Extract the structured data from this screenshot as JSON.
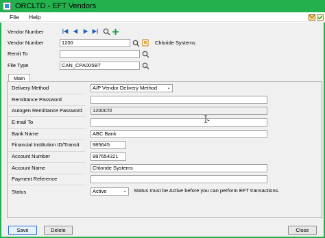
{
  "window": {
    "title": "ORCLTD - EFT Vendors"
  },
  "menu": {
    "file": "File",
    "help": "Help"
  },
  "header": {
    "vendor_number_nav_label": "Vendor Number",
    "vendor_number_label": "Vendor Number",
    "vendor_number_value": "1200",
    "vendor_name": "Chloride Systems",
    "remit_to_label": "Remit To",
    "remit_to_value": "",
    "file_type_label": "File Type",
    "file_type_value": "CAN_CPA005BT"
  },
  "tabs": [
    {
      "label": "Main"
    }
  ],
  "main": {
    "delivery_method_label": "Delivery Method",
    "delivery_method_value": "A/P Vendor Delivery Method",
    "remittance_password_label": "Remittance Password",
    "remittance_password_value": "",
    "autogen_password_label": "Autogen Remittance Password",
    "autogen_password_value": "1200Chl",
    "email_to_label": "E-mail To",
    "email_to_value": "",
    "bank_name_label": "Bank Name",
    "bank_name_value": "ABC Bank",
    "institution_transit_label": "Financial Institution ID/Transit",
    "institution_transit_value": "985645",
    "account_number_label": "Account Number",
    "account_number_value": "987654321",
    "account_name_label": "Account Name",
    "account_name_value": "Chloride Systems",
    "payment_reference_label": "Payment Reference",
    "payment_reference_value": "",
    "status_label": "Status",
    "status_value": "Active",
    "status_note": "Status must be Active before you can perform EFT transactions."
  },
  "buttons": {
    "save": "Save",
    "delete": "Delete",
    "close": "Close"
  },
  "colors": {
    "titlebar": "#22b14c",
    "nav_icons": "#1f5fbf",
    "add_icon": "#1e9e3e"
  }
}
